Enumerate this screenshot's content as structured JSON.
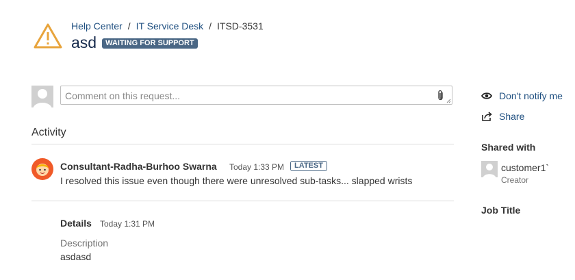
{
  "breadcrumb": {
    "items": [
      "Help Center",
      "IT Service Desk"
    ],
    "separator": "/",
    "current": "ITSD-3531"
  },
  "request": {
    "title": "asd",
    "status": "WAITING FOR SUPPORT"
  },
  "comment_input": {
    "placeholder": "Comment on this request..."
  },
  "activity": {
    "heading": "Activity",
    "comments": [
      {
        "author": "Consultant-Radha-Burhoo Swarna",
        "time": "Today 1:33 PM",
        "badge": "LATEST",
        "body": "I resolved this issue even though there were unresolved sub-tasks... slapped wrists"
      }
    ],
    "details": {
      "label": "Details",
      "time": "Today 1:31 PM",
      "description_label": "Description",
      "description_value": "asdasd"
    }
  },
  "sidebar": {
    "notify_label": "Don't notify me",
    "share_label": "Share",
    "shared_with_heading": "Shared with",
    "participants": [
      {
        "name": "customer1`",
        "role": "Creator"
      }
    ],
    "job_title_heading": "Job Title"
  },
  "icons": {
    "warning": "warning-icon",
    "attachment": "paperclip-icon",
    "notify": "eye-icon",
    "share": "share-icon"
  },
  "colors": {
    "link": "#205081",
    "status_badge": "#4a6785",
    "warning": "#f0a53c"
  }
}
